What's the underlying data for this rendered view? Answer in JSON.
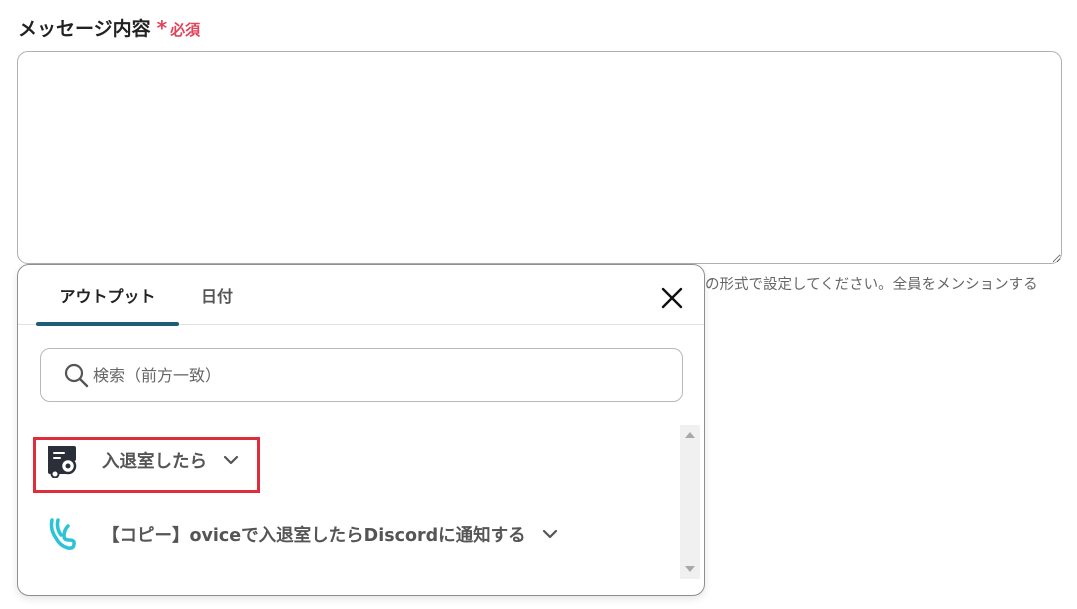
{
  "field": {
    "label": "メッセージ内容",
    "required_mark": "*",
    "required_text": "必須"
  },
  "textarea": {
    "value": "",
    "placeholder": ""
  },
  "hint_text": "の形式で設定してください。全員をメンションする",
  "panel": {
    "tabs": [
      {
        "label": "アウトプット",
        "active": true
      },
      {
        "label": "日付",
        "active": false
      }
    ],
    "close_icon": "close-icon",
    "search": {
      "placeholder": "検索（前方一致）",
      "value": "",
      "icon": "search-icon"
    },
    "items": [
      {
        "label": "入退室したら",
        "icon": "ovice-app-icon",
        "expand_icon": "chevron-down-icon",
        "highlighted": true
      },
      {
        "label": "【コピー】oviceで入退室したらDiscordに通知する",
        "icon": "yoom-flow-icon",
        "expand_icon": "chevron-down-icon",
        "highlighted": false
      }
    ]
  },
  "colors": {
    "required": "#e0445b",
    "tab_underline": "#1d5d76",
    "highlight_border": "#e02d3b",
    "flow_icon": "#2cc3d6"
  }
}
